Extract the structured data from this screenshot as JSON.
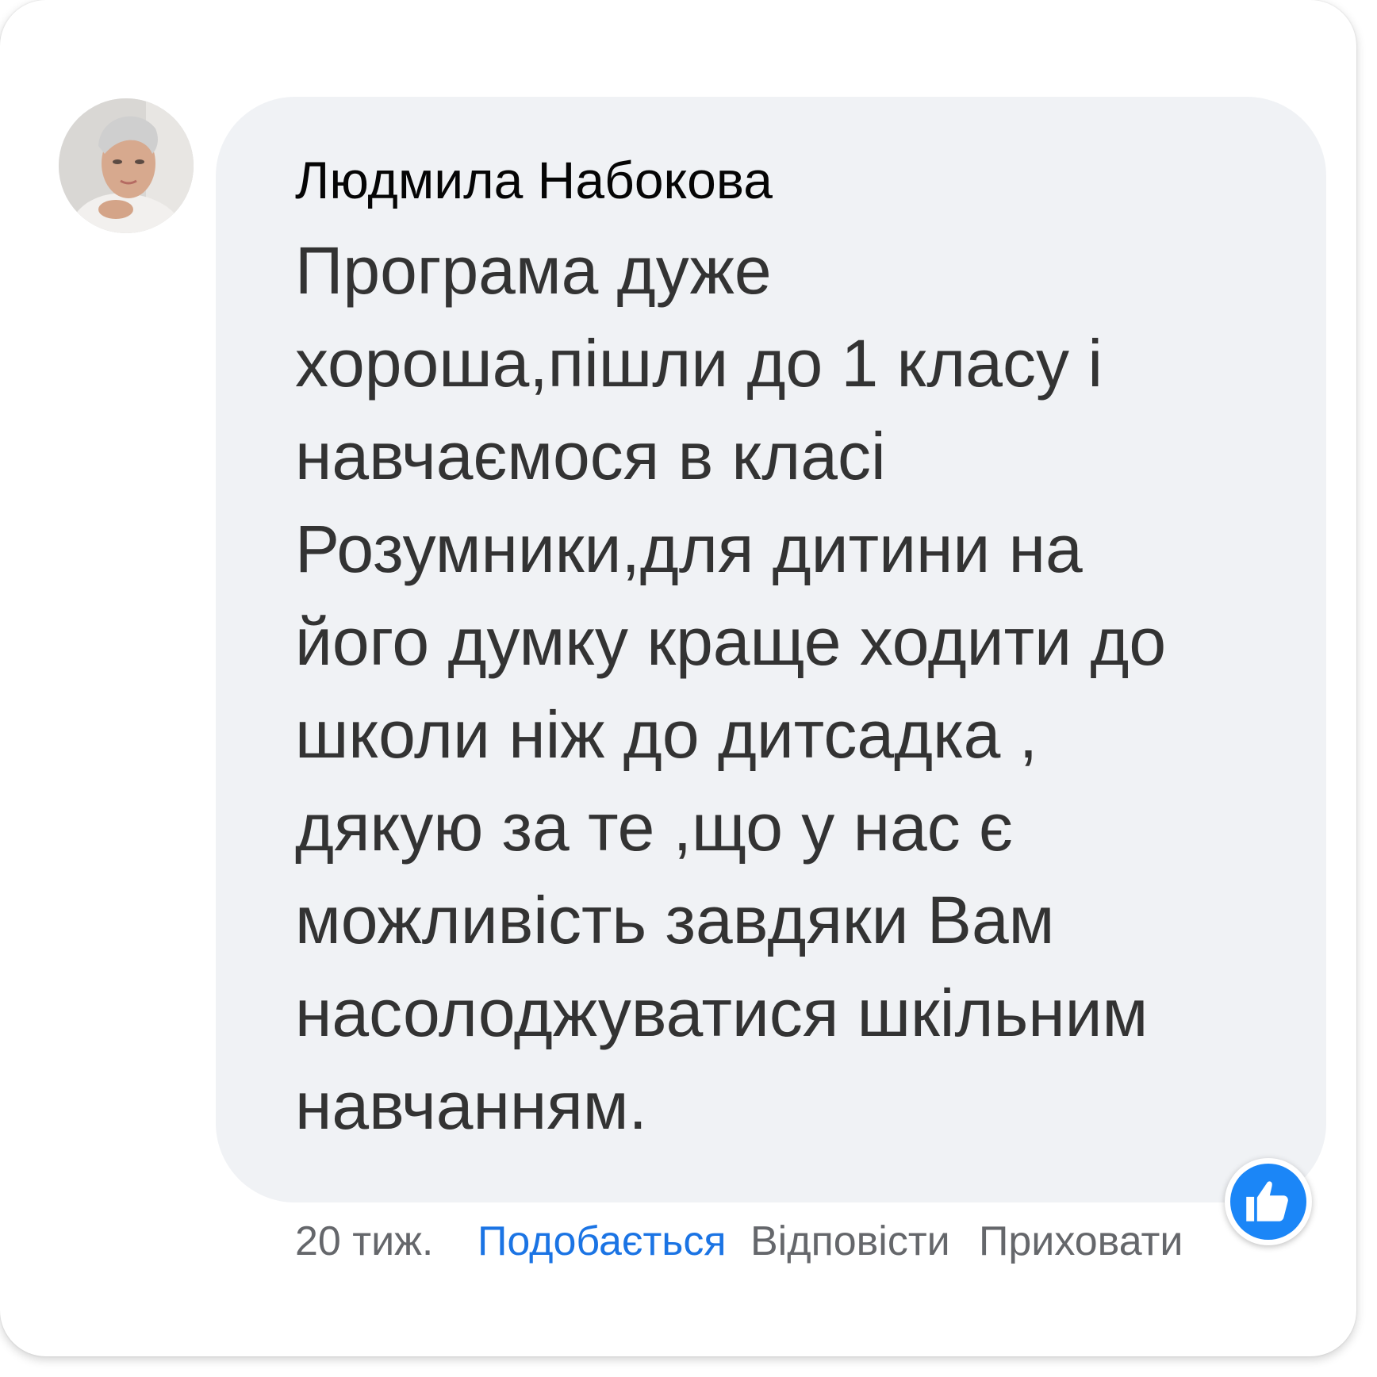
{
  "comment": {
    "author": "Людмила Набокова",
    "text": "Програма дуже\nхороша,пішли до 1 класу і\nнавчаємося в класі\nРозумники,для дитини на\nйого думку краще ходити до\nшколи ніж до дитсадка ,\nдякую за те ,що у нас є\nможливість завдяки Вам\nнасолоджуватися шкільним\nнавчанням.",
    "reactions": [
      "like-icon"
    ]
  },
  "actions": {
    "time": "20 тиж.",
    "like": "Подобається",
    "reply": "Відповісти",
    "hide": "Приховати"
  },
  "colors": {
    "bubble": "#f0f2f5",
    "like_blue": "#1b74e4",
    "reaction_blue": "#1b86f7",
    "muted_text": "#65676b"
  }
}
